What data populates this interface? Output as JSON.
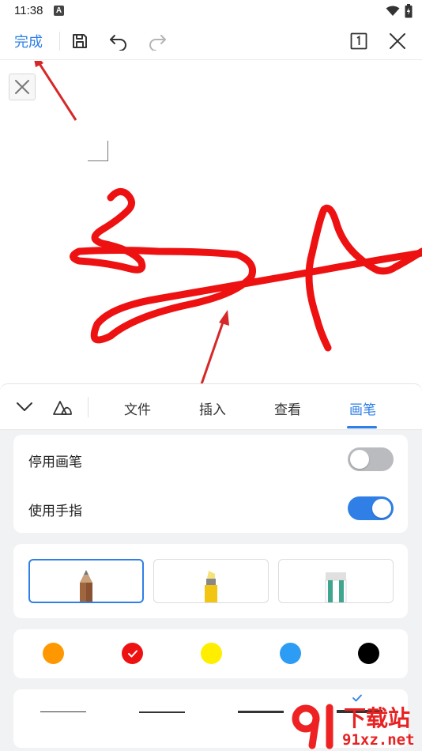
{
  "status_bar": {
    "time": "11:38",
    "notif_letter": "A"
  },
  "toolbar": {
    "done_label": "完成"
  },
  "panel": {
    "tabs": [
      {
        "label": "文件",
        "active": false
      },
      {
        "label": "插入",
        "active": false
      },
      {
        "label": "查看",
        "active": false
      },
      {
        "label": "画笔",
        "active": true
      }
    ],
    "toggles": [
      {
        "label": "停用画笔",
        "on": false
      },
      {
        "label": "使用手指",
        "on": true
      }
    ],
    "pens": [
      {
        "type": "pencil",
        "selected": true
      },
      {
        "type": "highlighter",
        "selected": false
      },
      {
        "type": "eraser",
        "selected": false
      }
    ],
    "colors": [
      {
        "name": "orange",
        "hex": "#ff9800",
        "selected": false
      },
      {
        "name": "red",
        "hex": "#ee1111",
        "selected": true
      },
      {
        "name": "yellow",
        "hex": "#ffee00",
        "selected": false
      },
      {
        "name": "blue",
        "hex": "#2d9cf5",
        "selected": false
      },
      {
        "name": "black",
        "hex": "#000000",
        "selected": false
      }
    ],
    "stroke_widths_selected": 4
  },
  "colors": {
    "accent": "#2f7fe6",
    "ink": "#ee1111",
    "annotation_arrow": "#d62828"
  },
  "watermark": {
    "big": "下载站",
    "small": "91xz.net"
  }
}
